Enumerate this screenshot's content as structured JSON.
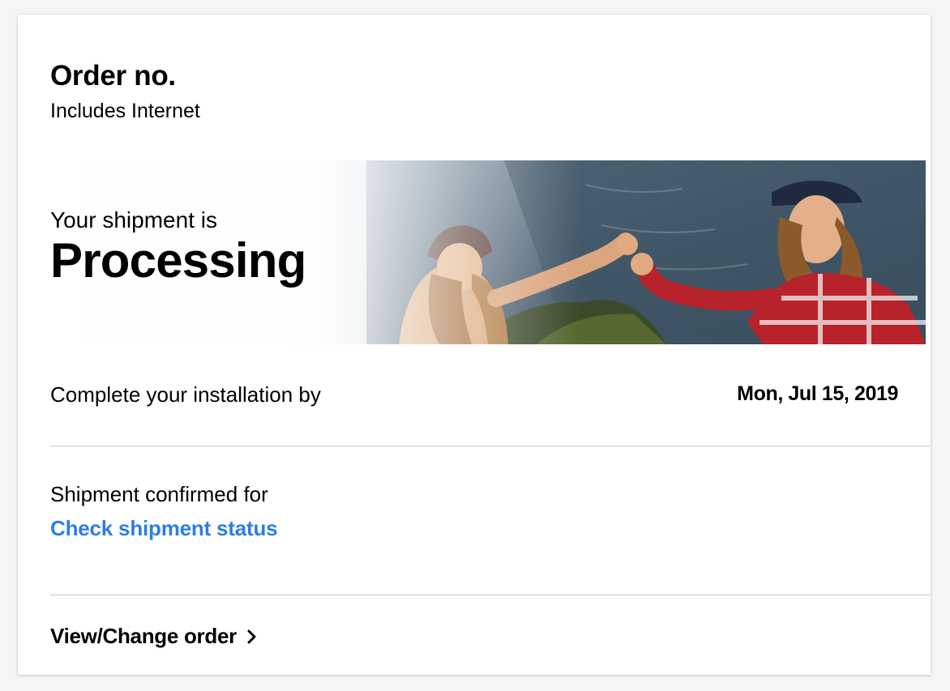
{
  "order": {
    "title": "Order no.",
    "subtitle": "Includes Internet"
  },
  "banner": {
    "prefix": "Your shipment is",
    "status": "Processing"
  },
  "installation": {
    "label": "Complete your installation by",
    "date": "Mon, Jul 15, 2019"
  },
  "shipment": {
    "label": "Shipment confirmed for",
    "link": "Check shipment status"
  },
  "actions": {
    "view_change": "View/Change order"
  },
  "colors": {
    "link": "#2d7fe0",
    "divider": "#c9c9c9",
    "card_bg": "#ffffff",
    "page_bg": "#f5f5f5"
  },
  "icons": {
    "view_change": "chevron-right-icon"
  }
}
